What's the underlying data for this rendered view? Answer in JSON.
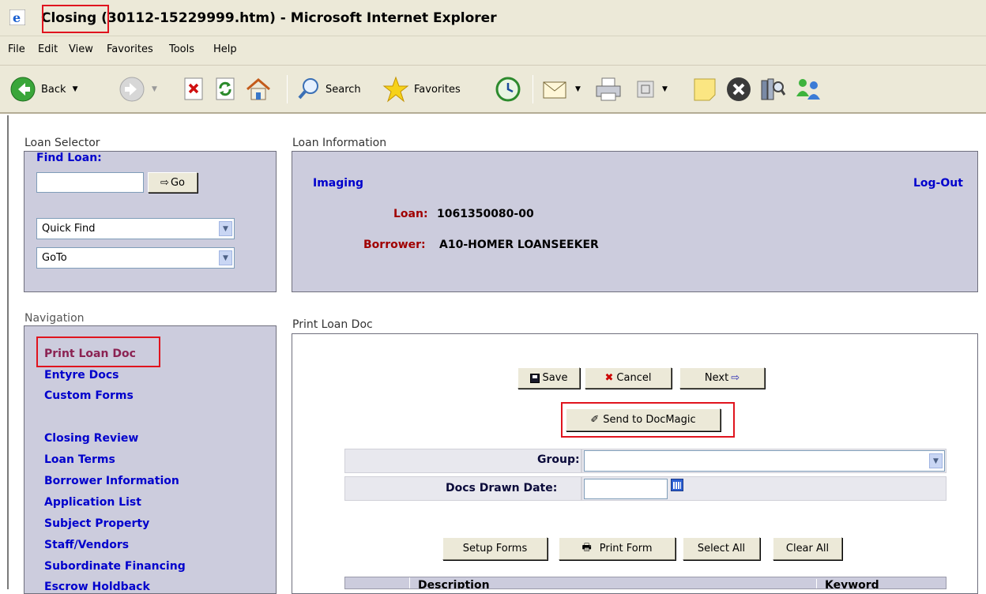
{
  "window": {
    "title_highlighted": "Closing (",
    "title_rest": "30112-15229999.htm) - Microsoft Internet Explorer"
  },
  "menu": [
    "File",
    "Edit",
    "View",
    "Favorites",
    "Tools",
    "Help"
  ],
  "toolbar": {
    "back_label": "Back",
    "search_label": "Search",
    "favorites_label": "Favorites"
  },
  "loan_selector": {
    "section_label": "Loan Selector",
    "find_loan_label": "Find Loan:",
    "find_loan_value": "",
    "go_label": "Go",
    "quick_find_value": "Quick Find",
    "goto_value": "GoTo"
  },
  "loan_information": {
    "section_label": "Loan Information",
    "imaging_link": "Imaging",
    "logout_link": "Log-Out",
    "loan_label": "Loan:",
    "loan_value": "1061350080-00",
    "borrower_label": "Borrower:",
    "borrower_value": "A10-HOMER LOANSEEKER"
  },
  "navigation": {
    "section_label": "Navigation",
    "active_item": "Print Loan Doc",
    "items_group1": [
      "Entyre Docs",
      "Custom Forms"
    ],
    "items_group2": [
      "Closing Review",
      "Loan Terms",
      "Borrower Information",
      "Application List",
      "Subject Property",
      "Staff/Vendors",
      "Subordinate Financing",
      "Escrow Holdback"
    ]
  },
  "print_loan_doc": {
    "section_label": "Print Loan Doc",
    "save_label": "Save",
    "cancel_label": "Cancel",
    "next_label": "Next",
    "send_label": "Send to DocMagic",
    "group_label": "Group:",
    "group_value": "",
    "docs_drawn_label": "Docs Drawn Date:",
    "docs_drawn_value": "",
    "setup_forms_label": "Setup Forms",
    "print_form_label": "Print Form",
    "select_all_label": "Select All",
    "clear_all_label": "Clear All",
    "col_description": "Description",
    "col_keyword": "Keyword"
  },
  "colors": {
    "panel_bg": "#ccccdd",
    "link_blue": "#0000cc",
    "label_red": "#a00000",
    "highlight_red": "#e0141e"
  }
}
